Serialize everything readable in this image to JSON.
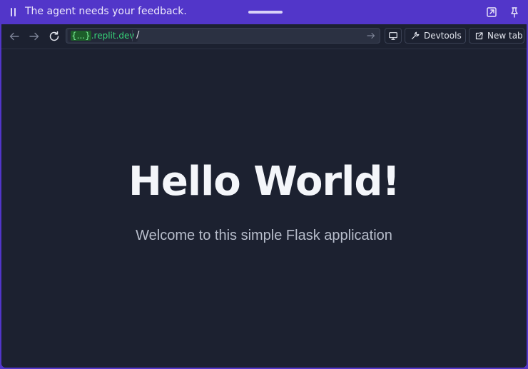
{
  "banner": {
    "message": "The agent needs your feedback.",
    "icons": [
      "pause-icon",
      "drag-handle",
      "open-external-icon",
      "pin-icon"
    ]
  },
  "toolbar": {
    "back_icon": "arrow-left-icon",
    "forward_icon": "arrow-right-icon",
    "reload_icon": "reload-icon",
    "url": {
      "curly": "{...}",
      "domain_suffix": ".replit.dev",
      "path": "/"
    },
    "screen_icon": "monitor-icon",
    "devtools_label": "Devtools",
    "new_tab_label": "New tab"
  },
  "page": {
    "heading": "Hello World!",
    "subtitle": "Welcome to this simple Flask application"
  },
  "colors": {
    "banner_bg": "#5236c9",
    "page_bg": "#1c2130",
    "domain_green": "#37d67a",
    "heading_text": "#f4f6fa",
    "subtitle_text": "#b7bdcb"
  }
}
